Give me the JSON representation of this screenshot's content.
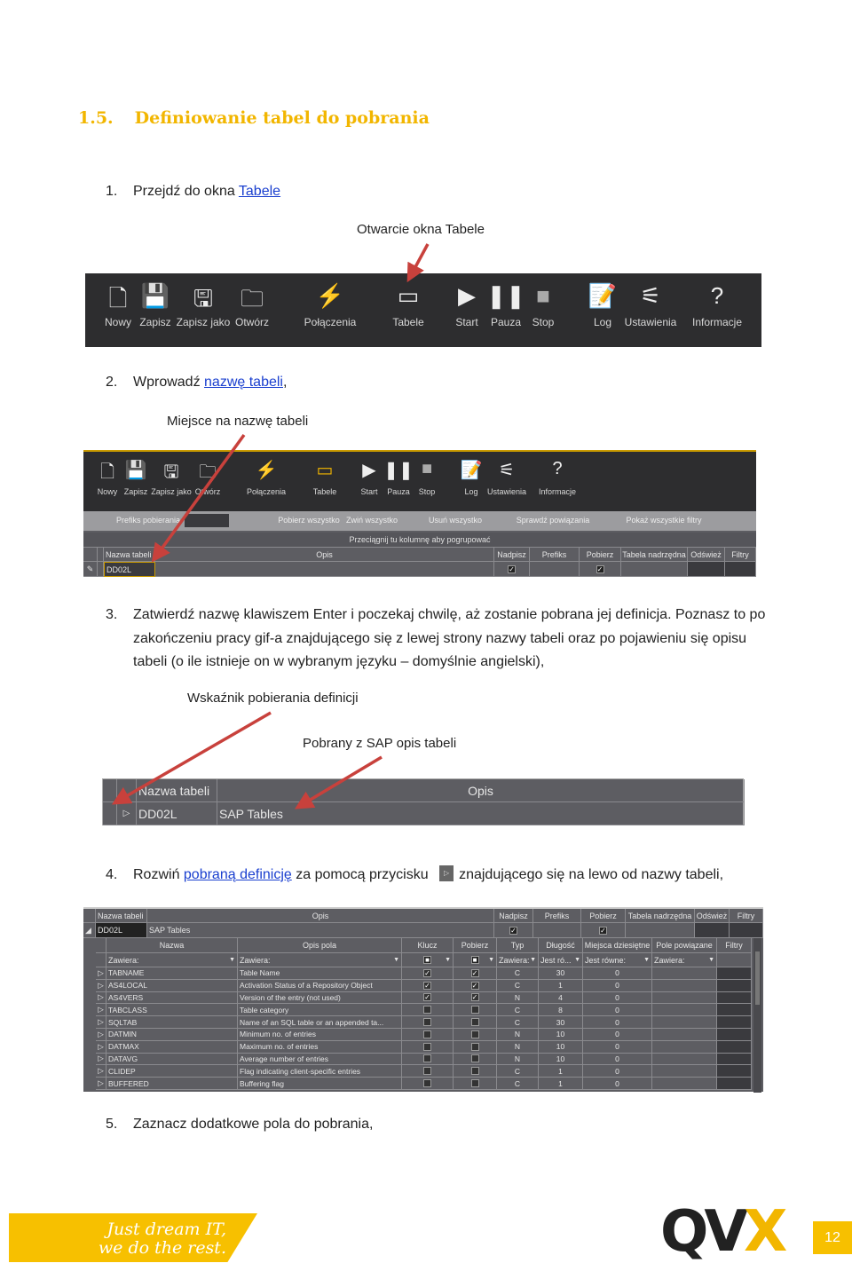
{
  "heading": {
    "number": "1.5.",
    "title": "Definiowanie tabel do pobrania"
  },
  "steps": [
    {
      "num": "1.",
      "pre": "Przejdź do okna ",
      "link": "Tabele",
      "post": ""
    },
    {
      "num": "2.",
      "pre": "Wprowadź ",
      "link": "nazwę tabeli",
      "post": ","
    },
    {
      "num": "3.",
      "text": "Zatwierdź nazwę klawiszem Enter i poczekaj chwilę, aż zostanie pobrana jej definicja. Poznasz to po zakończeniu pracy gif-a znajdującego się z lewej strony nazwy tabeli oraz po pojawieniu się opisu tabeli (o ile istnieje on w wybranym języku – domyślnie angielski),"
    },
    {
      "num": "4.",
      "pre": "Rozwiń ",
      "link": "pobraną definicję",
      "mid": " za pomocą przycisku ",
      "post": "znajdującego się na lewo od nazwy tabeli,"
    },
    {
      "num": "5.",
      "text": "Zaznacz dodatkowe pola do pobrania,"
    }
  ],
  "captions": {
    "open_tables": "Otwarcie okna Tabele",
    "name_place": "Miejsce na nazwę tabeli",
    "indicator": "Wskaźnik pobierania definicji",
    "sap_desc": "Pobrany z SAP opis tabeli"
  },
  "toolbar": {
    "items": [
      {
        "label": "Nowy",
        "icon": "new-file-icon"
      },
      {
        "label": "Zapisz",
        "icon": "save-icon"
      },
      {
        "label": "Zapisz jako",
        "icon": "save-as-icon"
      },
      {
        "label": "Otwórz",
        "icon": "open-folder-icon"
      },
      {
        "label": "Połączenia",
        "icon": "lightning-icon"
      },
      {
        "label": "Tabele",
        "icon": "table-window-icon"
      },
      {
        "label": "Start",
        "icon": "play-icon"
      },
      {
        "label": "Pauza",
        "icon": "pause-icon"
      },
      {
        "label": "Stop",
        "icon": "stop-icon"
      },
      {
        "label": "Log",
        "icon": "log-icon"
      },
      {
        "label": "Ustawienia",
        "icon": "settings-sliders-icon"
      },
      {
        "label": "Informacje",
        "icon": "help-icon"
      }
    ]
  },
  "tables_window": {
    "actions": [
      "Prefiks pobierania",
      "Pobierz wszystko",
      "Zwiń wszystko",
      "Usuń wszystko",
      "Sprawdź powiązania",
      "Pokaż wszystkie filtry"
    ],
    "group_hint": "Przeciągnij tu kolumnę aby pogrupować",
    "columns": [
      "Nazwa tabeli",
      "Opis",
      "Nadpisz",
      "Prefiks",
      "Pobierz",
      "Tabela nadrzędna",
      "Odśwież",
      "Filtry"
    ],
    "row": {
      "name": "DD02L",
      "desc": "SAP Tables",
      "overwrite": true,
      "download": true
    }
  },
  "fields": {
    "columns": [
      "Nazwa",
      "Opis pola",
      "Klucz",
      "Pobierz",
      "Typ",
      "Długość",
      "Miejsca dziesiętne",
      "Pole powiązane",
      "Filtry"
    ],
    "filters": [
      "Zawiera:",
      "Zawiera:",
      "",
      "",
      "Zawiera:",
      "Jest ró...",
      "Jest równe:",
      "Zawiera:"
    ],
    "rows": [
      {
        "name": "TABNAME",
        "desc": "Table Name",
        "key": true,
        "get": true,
        "type": "C",
        "len": "30",
        "dec": "0"
      },
      {
        "name": "AS4LOCAL",
        "desc": "Activation Status of a Repository Object",
        "key": true,
        "get": true,
        "type": "C",
        "len": "1",
        "dec": "0"
      },
      {
        "name": "AS4VERS",
        "desc": "Version of the entry (not used)",
        "key": true,
        "get": true,
        "type": "N",
        "len": "4",
        "dec": "0"
      },
      {
        "name": "TABCLASS",
        "desc": "Table category",
        "key": false,
        "get": false,
        "type": "C",
        "len": "8",
        "dec": "0"
      },
      {
        "name": "SQLTAB",
        "desc": "Name of an SQL table or an appended ta...",
        "key": false,
        "get": false,
        "type": "C",
        "len": "30",
        "dec": "0"
      },
      {
        "name": "DATMIN",
        "desc": "Minimum no. of entries",
        "key": false,
        "get": false,
        "type": "N",
        "len": "10",
        "dec": "0"
      },
      {
        "name": "DATMAX",
        "desc": "Maximum no. of entries",
        "key": false,
        "get": false,
        "type": "N",
        "len": "10",
        "dec": "0"
      },
      {
        "name": "DATAVG",
        "desc": "Average number of entries",
        "key": false,
        "get": false,
        "type": "N",
        "len": "10",
        "dec": "0"
      },
      {
        "name": "CLIDEP",
        "desc": "Flag indicating client-specific entries",
        "key": false,
        "get": false,
        "type": "C",
        "len": "1",
        "dec": "0"
      },
      {
        "name": "BUFFERED",
        "desc": "Buffering flag",
        "key": false,
        "get": false,
        "type": "C",
        "len": "1",
        "dec": "0"
      }
    ]
  },
  "footer": {
    "slogan_line1": "Just dream IT,",
    "slogan_line2": "we do the rest.",
    "logo": "QVX",
    "page": "12"
  },
  "colors": {
    "accent": "#f2b600",
    "toolbar": "#2d2d2f",
    "grid": "#5d5d62",
    "arrow": "#c8413c",
    "link": "#1a3fcf"
  }
}
